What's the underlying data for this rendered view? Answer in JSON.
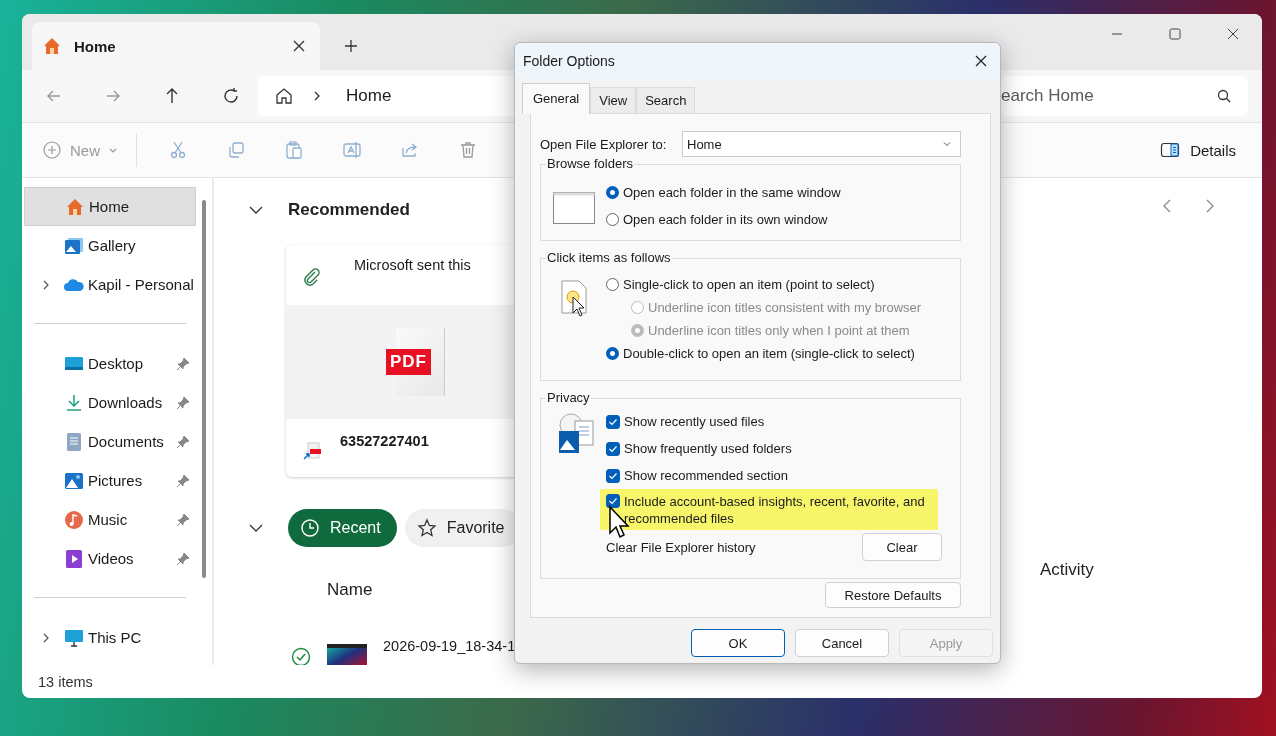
{
  "explorer": {
    "tab": {
      "title": "Home"
    },
    "address": {
      "crumbs": [
        "Home"
      ]
    },
    "search": {
      "placeholder": "earch Home"
    },
    "toolbar": {
      "new_label": "New",
      "details_label": "Details"
    },
    "sidebar": {
      "sections": [
        [
          {
            "label": "Home",
            "kind": "home",
            "selected": true,
            "expandable": false,
            "pinned": false
          },
          {
            "label": "Gallery",
            "kind": "gallery",
            "selected": false,
            "expandable": false,
            "pinned": false
          },
          {
            "label": "Kapil - Personal",
            "kind": "cloud",
            "selected": false,
            "expandable": true,
            "pinned": false
          }
        ],
        [
          {
            "label": "Desktop",
            "kind": "desktop",
            "selected": false,
            "expandable": false,
            "pinned": true
          },
          {
            "label": "Downloads",
            "kind": "downloads",
            "selected": false,
            "expandable": false,
            "pinned": true
          },
          {
            "label": "Documents",
            "kind": "documents",
            "selected": false,
            "expandable": false,
            "pinned": true
          },
          {
            "label": "Pictures",
            "kind": "pictures",
            "selected": false,
            "expandable": false,
            "pinned": true
          },
          {
            "label": "Music",
            "kind": "music",
            "selected": false,
            "expandable": false,
            "pinned": true
          },
          {
            "label": "Videos",
            "kind": "videos",
            "selected": false,
            "expandable": false,
            "pinned": true
          }
        ],
        [
          {
            "label": "This PC",
            "kind": "pc",
            "selected": false,
            "expandable": true,
            "pinned": false
          }
        ]
      ]
    },
    "recommended": {
      "title": "Recommended",
      "card": {
        "source": "Microsoft sent this",
        "badge": "PDF",
        "file": "63527227401"
      }
    },
    "filters": [
      {
        "label": "Recent",
        "kind": "recent",
        "selected": true
      },
      {
        "label": "Favorite",
        "kind": "favorites",
        "selected": false
      }
    ],
    "columns": [
      "Name",
      "Activity"
    ],
    "rows": [
      {
        "name": "2026-09-19_18-34-1",
        "synced": true
      }
    ],
    "status": "13 items"
  },
  "dialog": {
    "title": "Folder Options",
    "tabs": [
      {
        "label": "General",
        "selected": true
      },
      {
        "label": "View",
        "selected": false
      },
      {
        "label": "Search",
        "selected": false
      }
    ],
    "open_to": {
      "label": "Open File Explorer to:",
      "value": "Home"
    },
    "browse": {
      "title": "Browse folders",
      "options": [
        {
          "label": "Open each folder in the same window",
          "selected": true
        },
        {
          "label": "Open each folder in its own window",
          "selected": false
        }
      ]
    },
    "click": {
      "title": "Click items as follows",
      "options": [
        {
          "label": "Single-click to open an item (point to select)",
          "selected": false,
          "children": [
            {
              "label": "Underline icon titles consistent with my browser",
              "selected": false,
              "disabled": true
            },
            {
              "label": "Underline icon titles only when I point at them",
              "selected": true,
              "disabled": true
            }
          ]
        },
        {
          "label": "Double-click to open an item (single-click to select)",
          "selected": true
        }
      ]
    },
    "privacy": {
      "title": "Privacy",
      "options": [
        {
          "label": "Show recently used files",
          "checked": true,
          "highlighted": false
        },
        {
          "label": "Show frequently used folders",
          "checked": true,
          "highlighted": false
        },
        {
          "label": "Show recommended section",
          "checked": true,
          "highlighted": false
        },
        {
          "label": "Include account-based insights, recent, favorite, and recommended files",
          "checked": true,
          "highlighted": true
        }
      ],
      "clear_label": "Clear File Explorer history",
      "clear_button": "Clear"
    },
    "restore": "Restore Defaults",
    "buttons": [
      {
        "label": "OK",
        "default": true,
        "disabled": false
      },
      {
        "label": "Cancel",
        "default": false,
        "disabled": false
      },
      {
        "label": "Apply",
        "default": false,
        "disabled": true
      }
    ]
  }
}
